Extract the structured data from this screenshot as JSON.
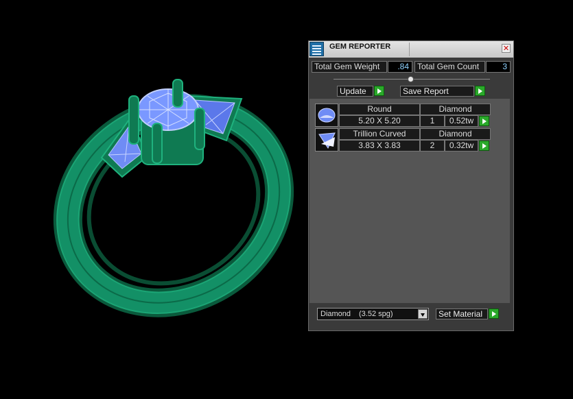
{
  "window": {
    "title": "GEM REPORTER",
    "close_glyph": "✕"
  },
  "summary": {
    "weight_label": "Total Gem Weight",
    "weight_value": ".84",
    "count_label": "Total Gem Count",
    "count_value": "3"
  },
  "actions": {
    "update_label": "Update",
    "save_label": "Save Report"
  },
  "gems": [
    {
      "shape": "Round",
      "material": "Diamond",
      "size": "5.20 X 5.20",
      "count": "1",
      "weight": "0.52tw",
      "icon": "round-gem-icon"
    },
    {
      "shape": "Trillion Curved",
      "material": "Diamond",
      "size": "3.83 X 3.83",
      "count": "2",
      "weight": "0.32tw",
      "icon": "trillion-gem-icon"
    }
  ],
  "material": {
    "name": "Diamond",
    "spg": "(3.52 spg)",
    "set_label": "Set Material"
  },
  "colors": {
    "ring_metal": "#0f7a52",
    "gem_blue": "#7a98ff",
    "accent_green": "#2aa82a",
    "value_text": "#8fd2ff"
  }
}
